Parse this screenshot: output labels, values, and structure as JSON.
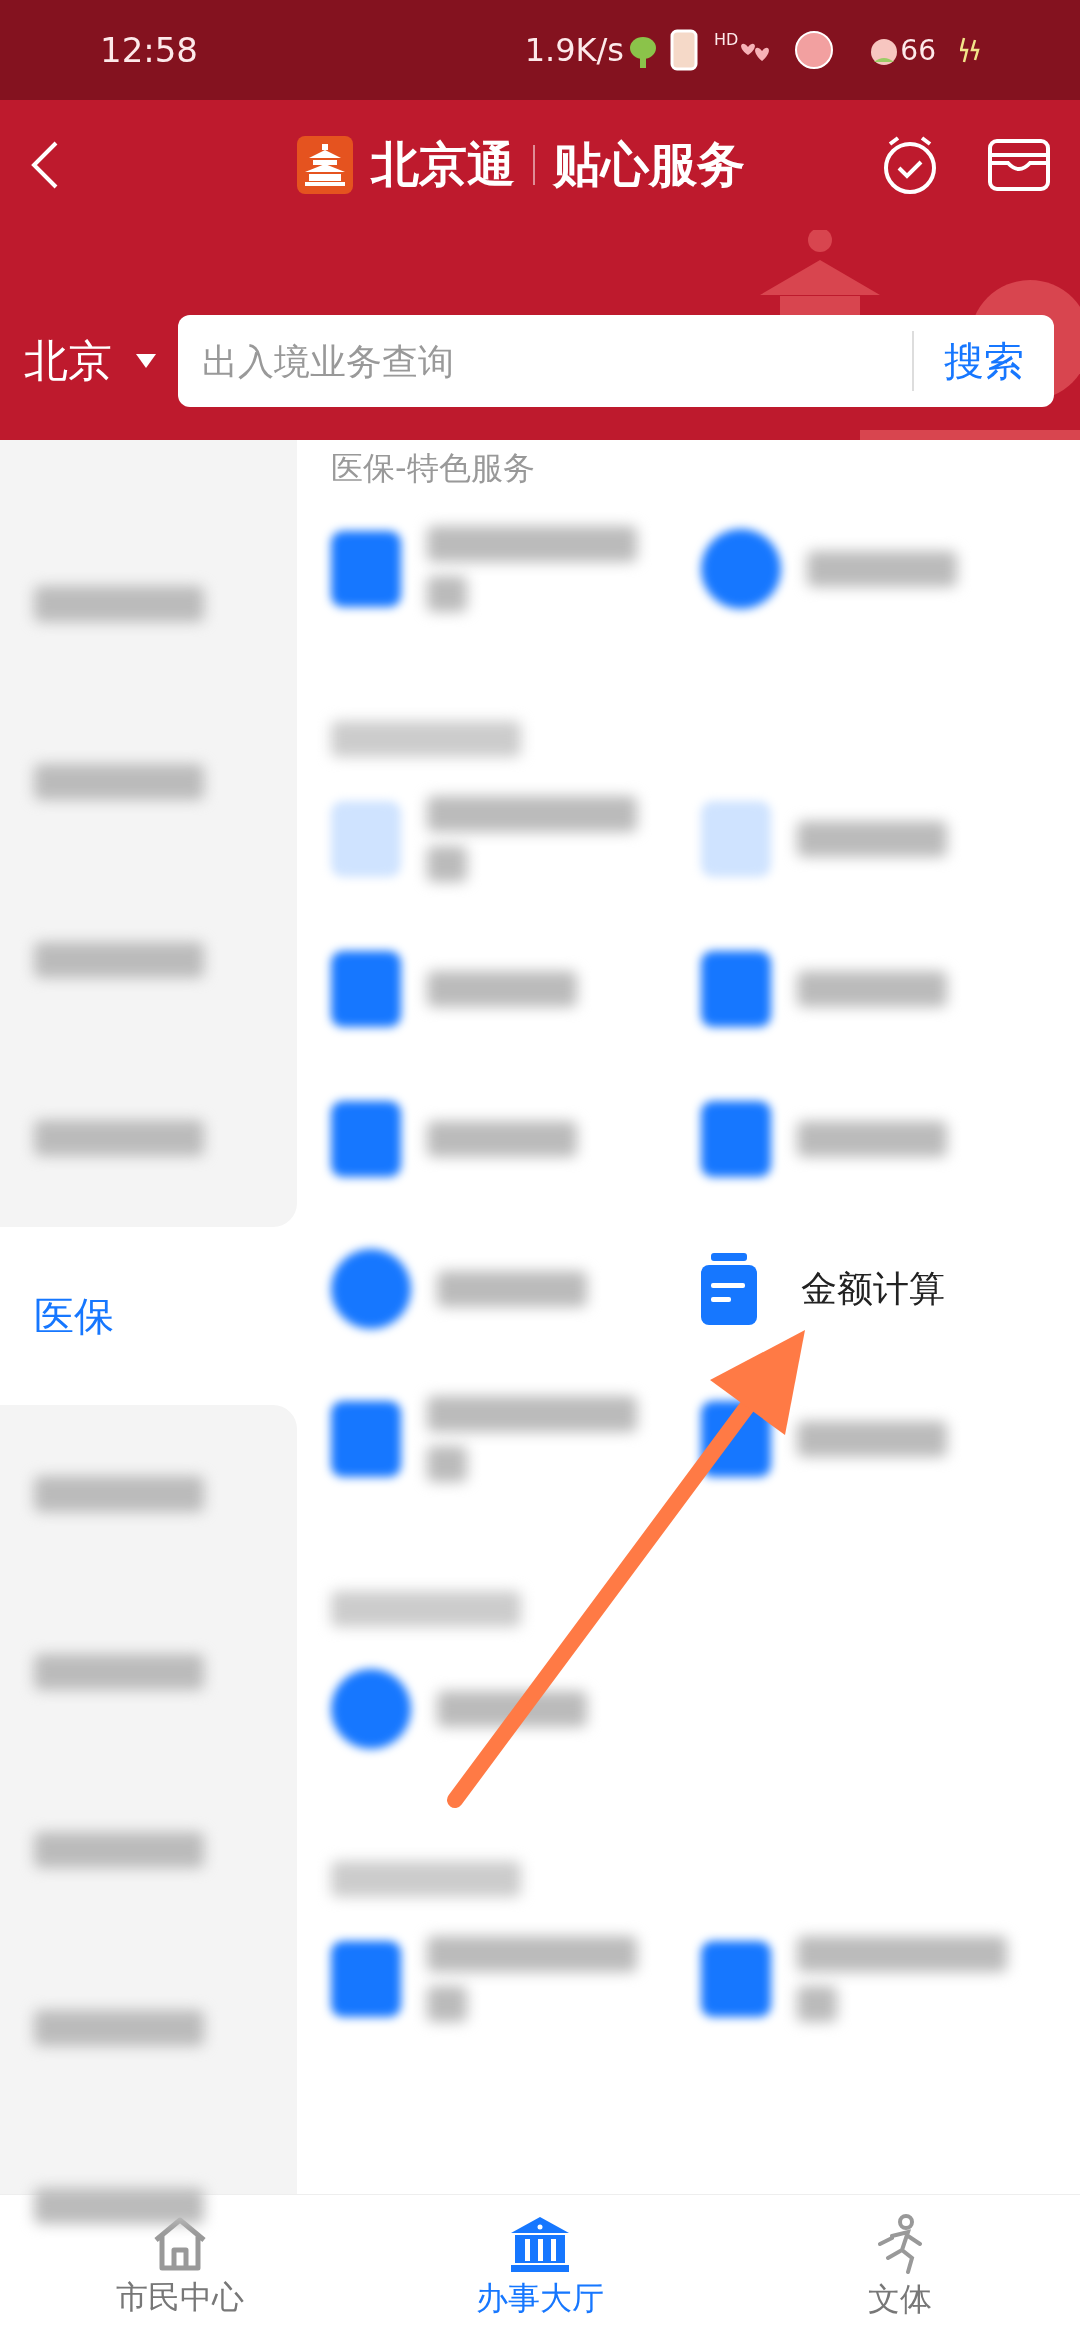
{
  "status_bar": {
    "time": "12:58",
    "speed": "1.9K/s",
    "hd": "HD",
    "battery": "66"
  },
  "header": {
    "brand": "北京通",
    "slogan": "贴心服务"
  },
  "search": {
    "city": "北京",
    "placeholder": "出入境业务查询",
    "button": "搜索"
  },
  "sidebar": {
    "items": [
      {
        "kind": "blurred",
        "selected": false
      },
      {
        "kind": "blurred",
        "selected": false
      },
      {
        "kind": "blurred",
        "selected": false
      },
      {
        "kind": "blurred",
        "selected": false
      },
      {
        "kind": "text",
        "label": "医保",
        "selected": true
      },
      {
        "kind": "blurred",
        "selected": false
      },
      {
        "kind": "blurred",
        "selected": false
      },
      {
        "kind": "blurred",
        "selected": false
      },
      {
        "kind": "blurred",
        "selected": false
      },
      {
        "kind": "blurred",
        "selected": false
      }
    ]
  },
  "sections": [
    {
      "title": "医保-特色服务",
      "items": [
        {
          "kind": "square",
          "wrap": true
        },
        {
          "kind": "round",
          "wrap": false
        }
      ]
    },
    {
      "items": [
        {
          "kind": "pale",
          "wrap": true
        },
        {
          "kind": "pale",
          "wrap": false
        },
        {
          "kind": "square",
          "wrap": false
        },
        {
          "kind": "square",
          "wrap": false
        },
        {
          "kind": "square",
          "wrap": false
        },
        {
          "kind": "square",
          "wrap": false
        },
        {
          "kind": "round",
          "wrap": false
        },
        {
          "kind": "service",
          "label": "金额计算"
        },
        {
          "kind": "square",
          "wrap": true
        },
        {
          "kind": "square",
          "wrap": false
        }
      ]
    },
    {
      "items": [
        {
          "kind": "round",
          "wrap": false
        }
      ]
    },
    {
      "items": [
        {
          "kind": "square",
          "wrap": true
        },
        {
          "kind": "square",
          "wrap": true
        }
      ]
    }
  ],
  "bottom_nav": [
    {
      "label": "市民中心",
      "selected": false
    },
    {
      "label": "办事大厅",
      "selected": true
    },
    {
      "label": "文体",
      "selected": false
    }
  ]
}
